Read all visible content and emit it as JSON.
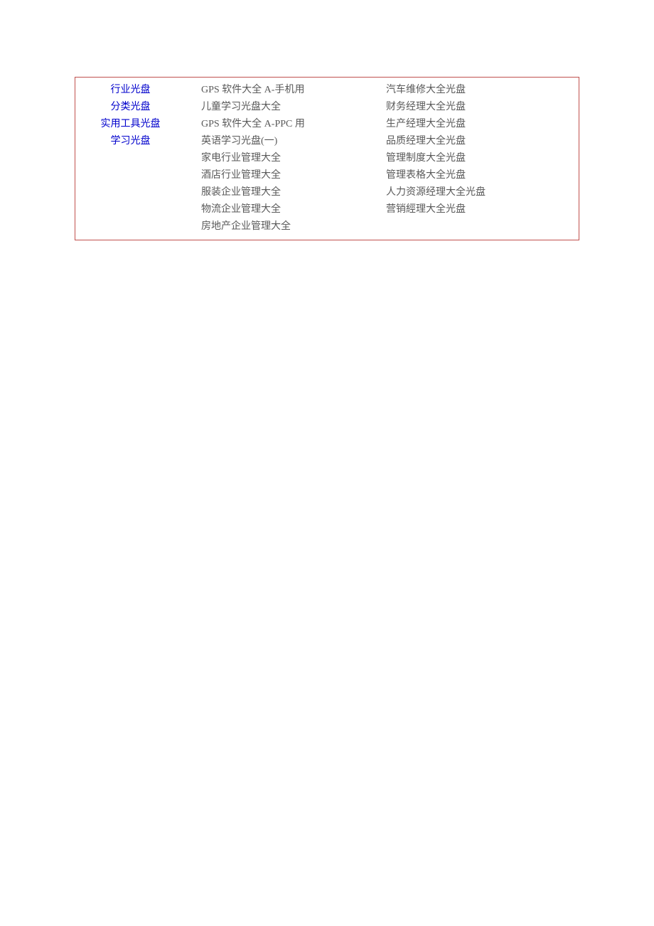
{
  "categories": [
    "行业光盘",
    "分类光盘",
    "实用工具光盘",
    "学习光盘"
  ],
  "column2": [
    "GPS 软件大全 A-手机用",
    "儿童学习光盘大全",
    "GPS 软件大全 A-PPC 用",
    "英语学习光盘(一)",
    "家电行业管理大全",
    "酒店行业管理大全",
    "服装企业管理大全",
    "物流企业管理大全",
    "房地产企业管理大全"
  ],
  "column3": [
    "汽车维修大全光盘",
    "财务经理大全光盘",
    "生产经理大全光盘",
    "品质经理大全光盘",
    "管理制度大全光盘",
    "管理表格大全光盘",
    "人力资源经理大全光盘",
    "营销經理大全光盘"
  ]
}
